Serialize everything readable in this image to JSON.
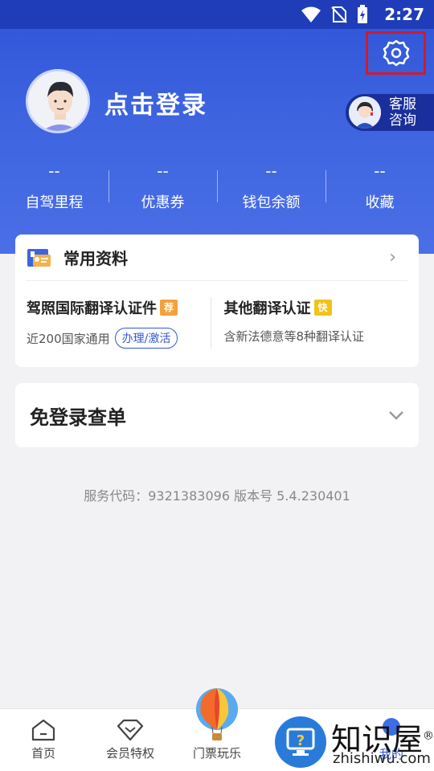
{
  "status": {
    "time": "2:27"
  },
  "header": {
    "login_text": "点击登录",
    "service_label": "客服咨询"
  },
  "stats": [
    {
      "value": "--",
      "label": "自驾里程"
    },
    {
      "value": "--",
      "label": "优惠券"
    },
    {
      "value": "--",
      "label": "钱包余额"
    },
    {
      "value": "--",
      "label": "收藏"
    }
  ],
  "common_info": {
    "title": "常用资料",
    "items": [
      {
        "title": "驾照国际翻译认证件",
        "tag": "荐",
        "sub": "近200国家通用",
        "action": "办理/激活"
      },
      {
        "title": "其他翻译认证",
        "tag": "快",
        "sub": "含新法德意等8种翻译认证"
      }
    ]
  },
  "order_query": {
    "title": "免登录查单"
  },
  "footer": {
    "info": "服务代码：9321383096  版本号 5.4.230401"
  },
  "tabs": [
    {
      "label": "首页"
    },
    {
      "label": "会员特权"
    },
    {
      "label": "门票玩乐"
    },
    {
      "label": "我的"
    }
  ],
  "watermark": {
    "title": "知识屋",
    "sub": "zhishiwu.com",
    "mark": "®"
  },
  "colors": {
    "primary": "#2f55d8",
    "highlight_box": "#d11a2a",
    "tag_orange": "#f3a23a",
    "tag_yellow": "#f1c21b"
  }
}
